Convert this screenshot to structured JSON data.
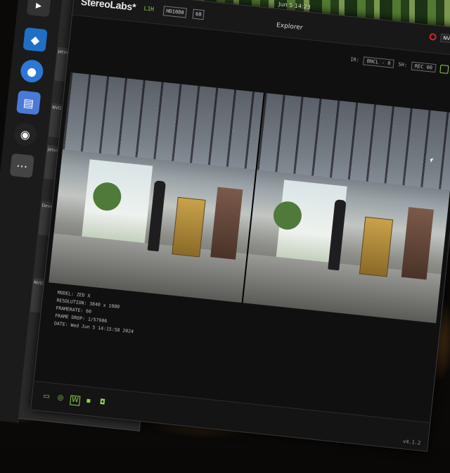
{
  "window": {
    "brand": "StereoLabs*",
    "library": "L1H",
    "resolution_select": "HD1080",
    "fps_select": "60",
    "title": "Explorer",
    "clock": "Jun 5 14:23",
    "nvidia_badge": "NVIDIA"
  },
  "toolbar": {
    "sensor_label": "IR:",
    "sensor_value": "BNCL - 0",
    "depth_label": "SH:",
    "depth_value": "REC 00"
  },
  "camera_info": {
    "model": "MODEL: ZED X",
    "resolution": "RESOLUTION: 3840 x 1080",
    "framerate": "FRAMERATE: 60",
    "frame_drop": "FRAME DROP: 1/57906",
    "date": "DATE: Wed Jun 5 14:15:58 2024"
  },
  "bottom": {
    "version": "v4.1.2"
  },
  "dock": {
    "items": [
      {
        "icon": "terminal-icon",
        "glyph": "▸"
      },
      {
        "icon": "vscode-icon",
        "glyph": "◆"
      },
      {
        "icon": "chromium-icon",
        "glyph": "●"
      },
      {
        "icon": "files-icon",
        "glyph": "▤"
      },
      {
        "icon": "obs-icon",
        "glyph": "◉"
      },
      {
        "icon": "apps-icon",
        "glyph": "⋯"
      }
    ]
  },
  "background_windows": {
    "labels": [
      "Jetson",
      "NVID",
      "Jetson",
      "Devel",
      "NVID"
    ]
  },
  "colors": {
    "accent": "#8fd14f",
    "record": "#d02828"
  }
}
